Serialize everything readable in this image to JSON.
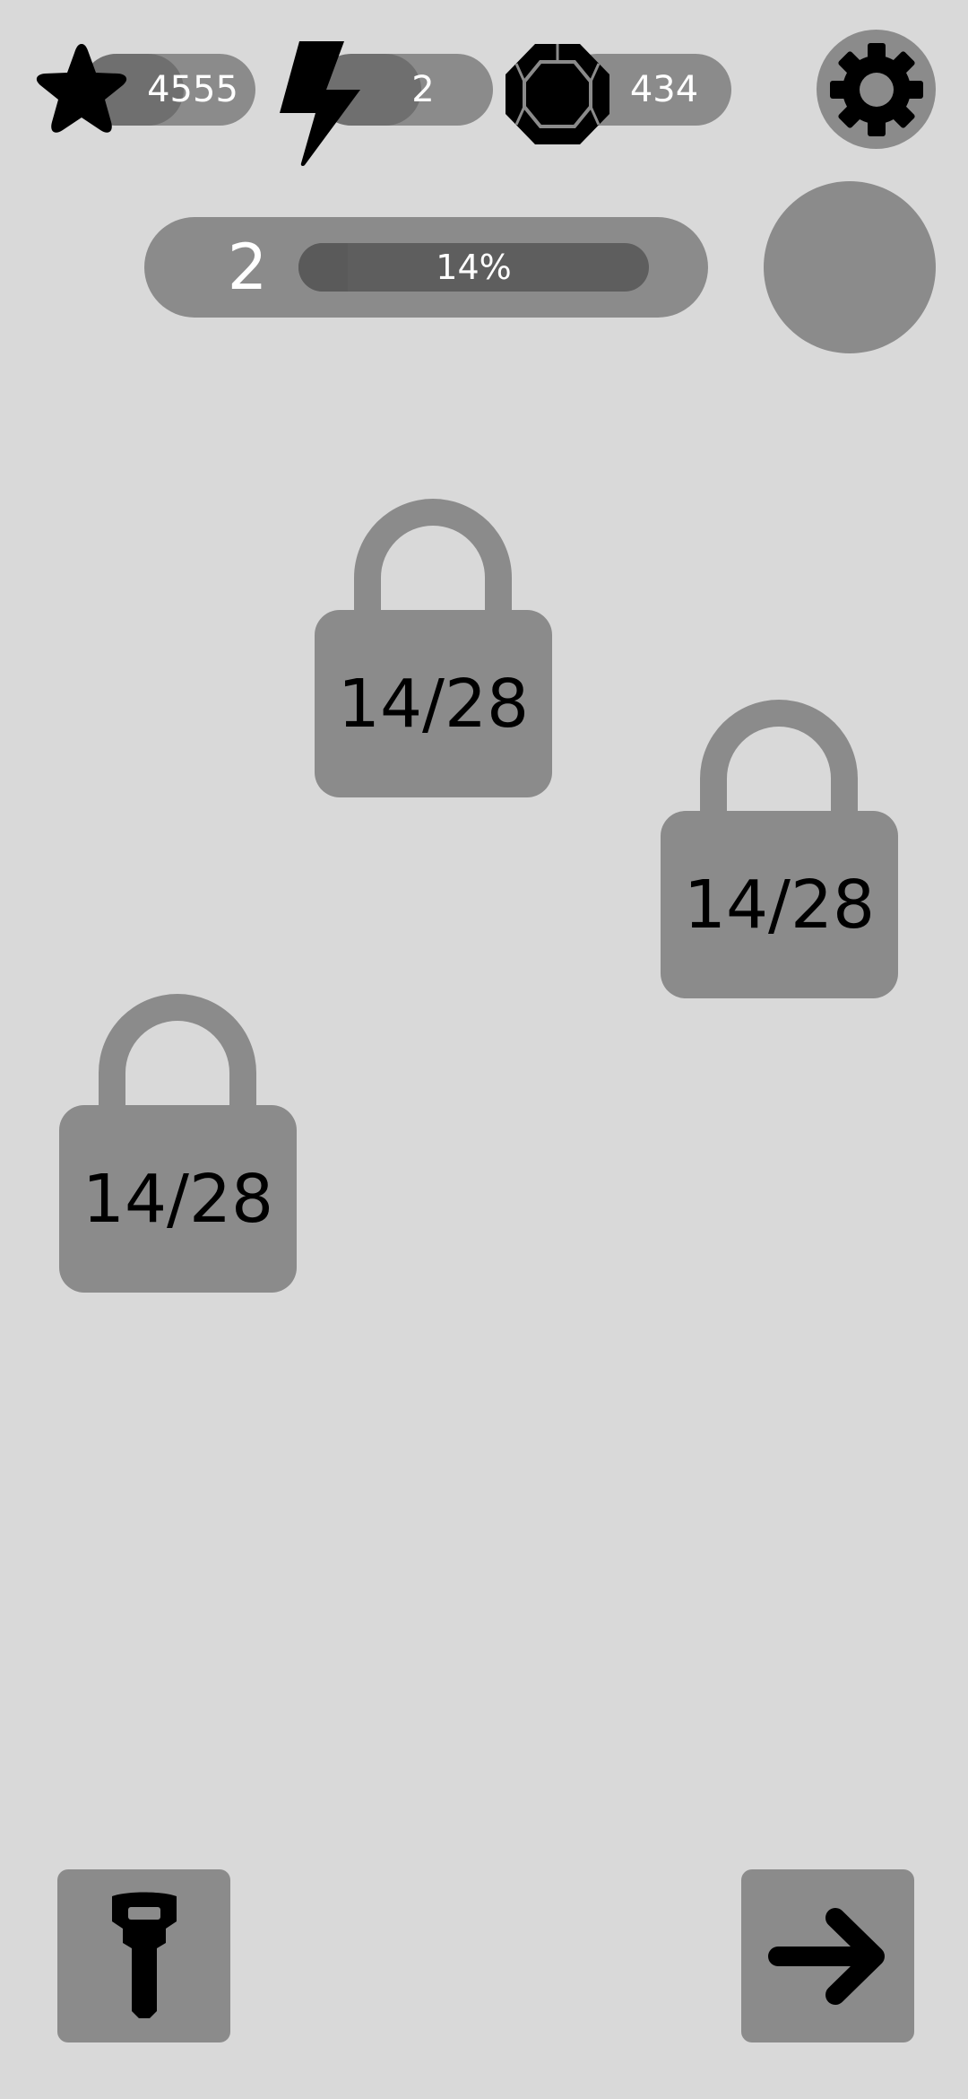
{
  "currencies": {
    "stars": {
      "value": "4555",
      "icon": "star-icon",
      "fill_fraction": 0.6
    },
    "energy": {
      "value": "2",
      "icon": "lightning-icon",
      "fill_fraction": 0.6
    },
    "gems": {
      "value": "434",
      "icon": "gem-icon",
      "fill_fraction": 0.0
    }
  },
  "settings": {
    "icon": "gear-icon"
  },
  "level": {
    "number": "2",
    "progress_label": "14%",
    "progress_fraction": 0.14
  },
  "locks": [
    {
      "label": "14/28",
      "icon": "padlock-icon"
    },
    {
      "label": "14/28",
      "icon": "padlock-icon"
    },
    {
      "label": "14/28",
      "icon": "padlock-icon"
    }
  ],
  "bottom_bar": {
    "key_button": {
      "icon": "key-icon"
    },
    "next_button": {
      "icon": "arrow-right-icon"
    }
  },
  "colors": {
    "background": "#d9d9d9",
    "panel": "#8b8b8b",
    "dark": "#5e5e5e",
    "text_light": "#ffffff",
    "text_dark": "#000000"
  }
}
